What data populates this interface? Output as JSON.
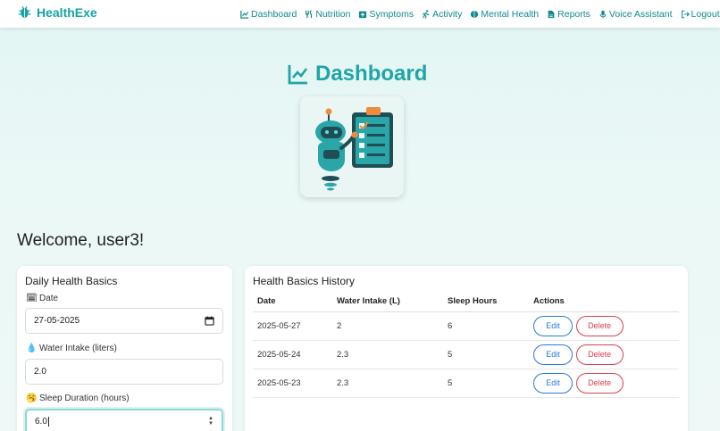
{
  "brand": {
    "name": "HealthExe",
    "icon": "bug-icon",
    "color": "#17a2a6"
  },
  "nav": [
    {
      "label": "Dashboard",
      "icon": "chart-line-icon"
    },
    {
      "label": "Nutrition",
      "icon": "utensils-icon"
    },
    {
      "label": "Symptoms",
      "icon": "notes-medical-icon"
    },
    {
      "label": "Activity",
      "icon": "running-icon"
    },
    {
      "label": "Mental Health",
      "icon": "brain-icon"
    },
    {
      "label": "Reports",
      "icon": "file-icon"
    },
    {
      "label": "Voice Assistant",
      "icon": "microphone-icon"
    },
    {
      "label": "Logout",
      "icon": "sign-out-icon"
    }
  ],
  "page": {
    "title": "Dashboard",
    "welcome": "Welcome, user3!"
  },
  "form": {
    "title": "Daily Health Basics",
    "date_label": "Date",
    "date_value": "27-05-2025",
    "water_label": "Water Intake (liters)",
    "water_value": "2.0",
    "sleep_label": "Sleep Duration (hours)",
    "sleep_value": "6.0"
  },
  "history": {
    "title": "Health Basics History",
    "columns": [
      "Date",
      "Water Intake (L)",
      "Sleep Hours",
      "Actions"
    ],
    "rows": [
      {
        "date": "2025-05-27",
        "water": "2",
        "sleep": "6"
      },
      {
        "date": "2025-05-24",
        "water": "2.3",
        "sleep": "5"
      },
      {
        "date": "2025-05-23",
        "water": "2.3",
        "sleep": "5"
      }
    ],
    "edit_label": "Edit",
    "delete_label": "Delete"
  },
  "colors": {
    "accent": "#1fa5a6",
    "edit": "#2979d8",
    "delete": "#d9414f"
  }
}
